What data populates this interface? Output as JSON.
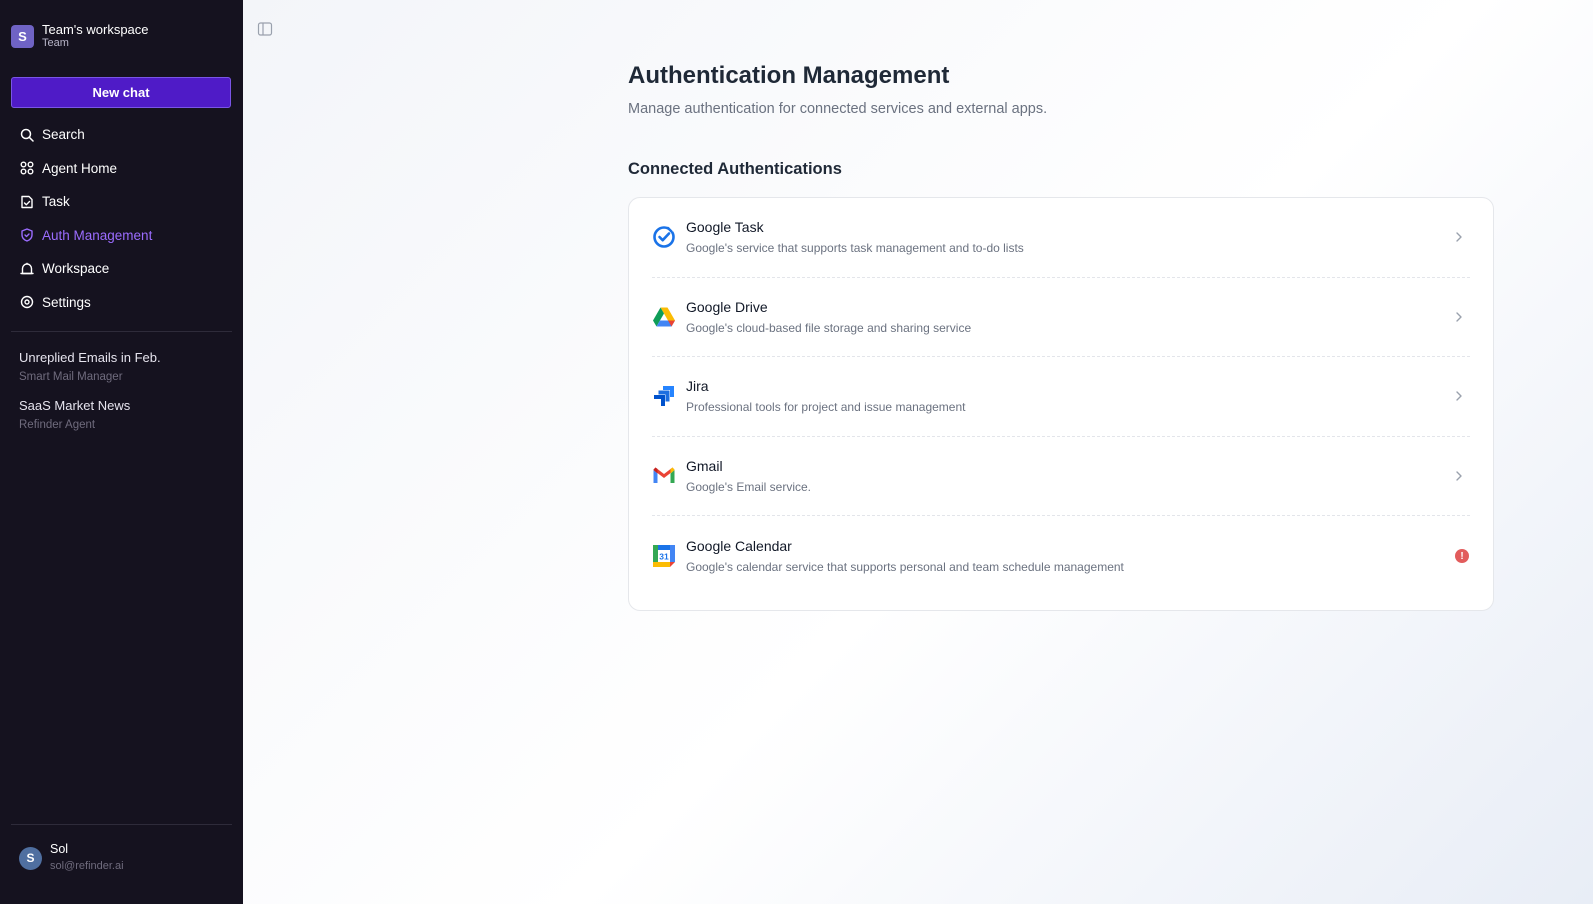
{
  "workspace": {
    "avatar_letter": "S",
    "name": "Team's workspace",
    "type": "Team"
  },
  "sidebar": {
    "new_chat_label": "New chat",
    "nav": [
      {
        "label": "Search",
        "icon": "search-icon"
      },
      {
        "label": "Agent Home",
        "icon": "agent-home-icon"
      },
      {
        "label": "Task",
        "icon": "task-icon"
      },
      {
        "label": "Auth Management",
        "icon": "shield-icon",
        "active": true
      },
      {
        "label": "Workspace",
        "icon": "workspace-icon"
      },
      {
        "label": "Settings",
        "icon": "settings-icon"
      }
    ],
    "recent": [
      {
        "title": "Unreplied Emails in Feb.",
        "agent": "Smart Mail Manager"
      },
      {
        "title": "SaaS Market News",
        "agent": "Refinder Agent"
      }
    ]
  },
  "user": {
    "avatar_letter": "S",
    "name": "Sol",
    "email": "sol@refinder.ai"
  },
  "main": {
    "title": "Authentication Management",
    "subtitle": "Manage authentication for connected services and external apps.",
    "section_title": "Connected Authentications",
    "services": [
      {
        "name": "Google Task",
        "desc": "Google's service that supports task management and to-do lists",
        "icon": "google-task-icon",
        "status": "ok"
      },
      {
        "name": "Google Drive",
        "desc": "Google's cloud-based file storage and sharing service",
        "icon": "google-drive-icon",
        "status": "ok"
      },
      {
        "name": "Jira",
        "desc": "Professional tools for project and issue management",
        "icon": "jira-icon",
        "status": "ok"
      },
      {
        "name": "Gmail",
        "desc": "Google's Email service.",
        "icon": "gmail-icon",
        "status": "ok"
      },
      {
        "name": "Google Calendar",
        "desc": "Google's calendar service that supports personal and team schedule management",
        "icon": "google-calendar-icon",
        "calendar_day": "31",
        "status": "error"
      }
    ]
  },
  "colors": {
    "sidebar_bg": "#15121f",
    "accent": "#4f1bc7",
    "active": "#9b6cff",
    "error": "#e25c5c"
  }
}
